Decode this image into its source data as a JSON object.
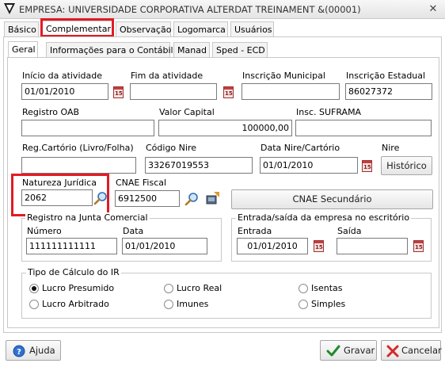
{
  "window": {
    "title": "EMPRESA: UNIVERSIDADE CORPORATIVA ALTERDAT TREINAMENT &(00001)",
    "close_glyph": "✕"
  },
  "main_tabs": [
    {
      "label": "Básico"
    },
    {
      "label": "Complementar"
    },
    {
      "label": "Observação"
    },
    {
      "label": "Logomarca"
    },
    {
      "label": "Usuários"
    }
  ],
  "sub_tabs": [
    {
      "label": "Geral"
    },
    {
      "label": "Informações para o Contábil"
    },
    {
      "label": "Manad"
    },
    {
      "label": "Sped - ECD"
    }
  ],
  "fields": {
    "inicio_atividade": {
      "label": "Início da atividade",
      "value": "01/01/2010"
    },
    "fim_atividade": {
      "label": "Fim da atividade",
      "value": ""
    },
    "inscricao_municipal": {
      "label": "Inscrição Municipal",
      "value": ""
    },
    "inscricao_estadual": {
      "label": "Inscrição Estadual",
      "value": "86027372"
    },
    "registro_oab": {
      "label": "Registro OAB",
      "value": ""
    },
    "valor_capital": {
      "label": "Valor Capital",
      "value": "100000,00"
    },
    "insc_suframa": {
      "label": "Insc. SUFRAMA",
      "value": ""
    },
    "reg_cartorio": {
      "label": "Reg.Cartório (Livro/Folha)",
      "value": ""
    },
    "codigo_nire": {
      "label": "Código Nire",
      "value": "33267019553"
    },
    "data_nire": {
      "label": "Data Nire/Cartório",
      "value": "01/01/2010"
    },
    "nire": {
      "label": "Nire"
    },
    "natureza_juridica": {
      "label": "Natureza Jurídica",
      "value": "2062"
    },
    "cnae_fiscal": {
      "label": "CNAE Fiscal",
      "value": "6912500"
    }
  },
  "calendar_glyph": "15",
  "buttons": {
    "historico": "Histórico",
    "cnae_secundario": "CNAE Secundário",
    "ajuda": "Ajuda",
    "gravar": "Gravar",
    "cancelar": "Cancelar"
  },
  "registro_junta": {
    "title": "Registro na Junta Comercial",
    "numero_label": "Número",
    "numero_value": "111111111111",
    "data_label": "Data",
    "data_value": "01/01/2010"
  },
  "entrada_saida": {
    "title": "Entrada/saída da empresa no escritório",
    "entrada_label": "Entrada",
    "entrada_value": "01/01/2010",
    "saida_label": "Saída",
    "saida_value": ""
  },
  "tipo_calculo": {
    "title": "Tipo de Cálculo do IR",
    "options": [
      {
        "label": "Lucro Presumido",
        "selected": true
      },
      {
        "label": "Lucro Real",
        "selected": false
      },
      {
        "label": "Isentas",
        "selected": false
      },
      {
        "label": "Lucro Arbitrado",
        "selected": false
      },
      {
        "label": "Imunes",
        "selected": false
      },
      {
        "label": "Simples",
        "selected": false
      }
    ]
  },
  "colors": {
    "highlight": "#e21b24",
    "window_bg": "#ffffff",
    "border": "#c8c8c8"
  }
}
